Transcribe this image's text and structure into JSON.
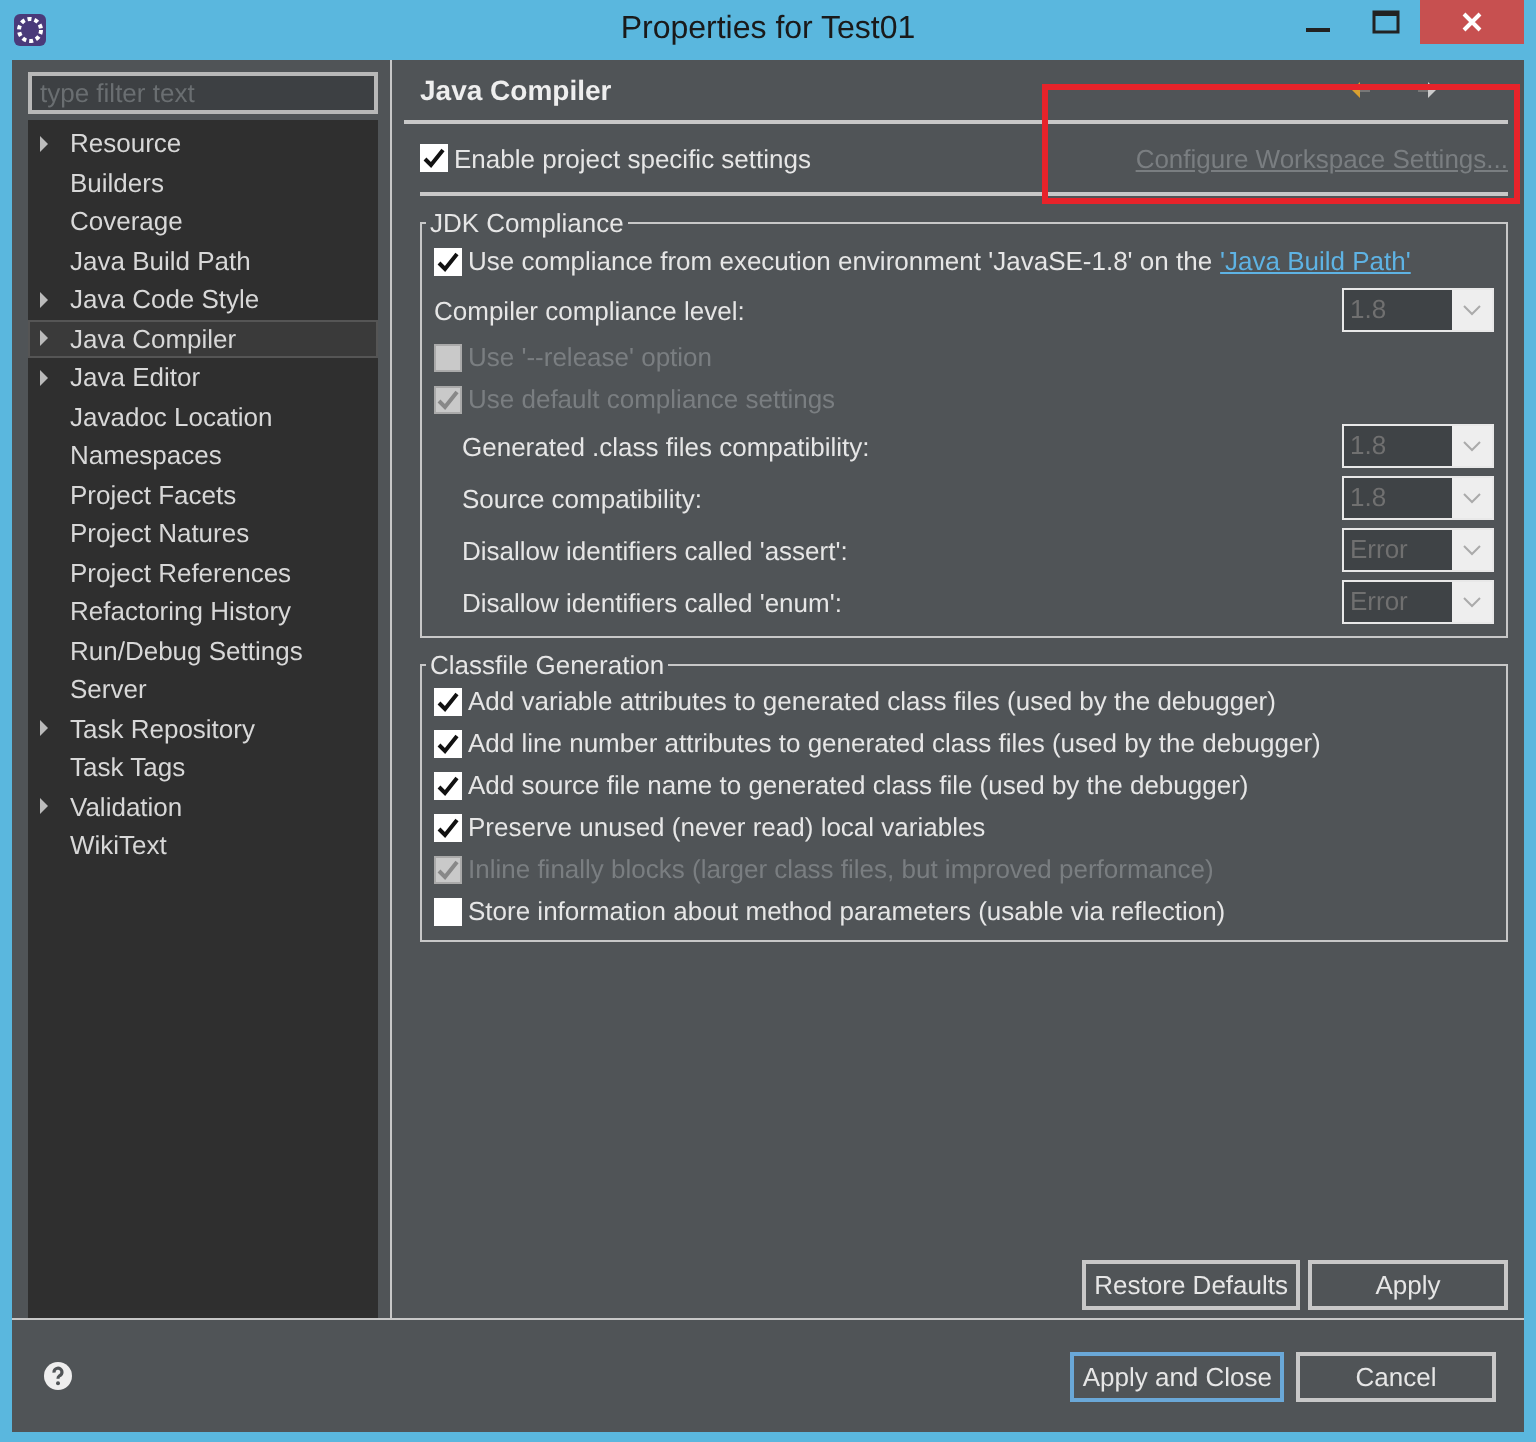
{
  "window": {
    "title": "Properties for Test01"
  },
  "filter": {
    "placeholder": "type filter text"
  },
  "sidebar": {
    "items": [
      {
        "label": "Resource",
        "expandable": true,
        "selected": false
      },
      {
        "label": "Builders",
        "expandable": false,
        "selected": false
      },
      {
        "label": "Coverage",
        "expandable": false,
        "selected": false
      },
      {
        "label": "Java Build Path",
        "expandable": false,
        "selected": false
      },
      {
        "label": "Java Code Style",
        "expandable": true,
        "selected": false
      },
      {
        "label": "Java Compiler",
        "expandable": true,
        "selected": true
      },
      {
        "label": "Java Editor",
        "expandable": true,
        "selected": false
      },
      {
        "label": "Javadoc Location",
        "expandable": false,
        "selected": false
      },
      {
        "label": "Namespaces",
        "expandable": false,
        "selected": false
      },
      {
        "label": "Project Facets",
        "expandable": false,
        "selected": false
      },
      {
        "label": "Project Natures",
        "expandable": false,
        "selected": false
      },
      {
        "label": "Project References",
        "expandable": false,
        "selected": false
      },
      {
        "label": "Refactoring History",
        "expandable": false,
        "selected": false
      },
      {
        "label": "Run/Debug Settings",
        "expandable": false,
        "selected": false
      },
      {
        "label": "Server",
        "expandable": false,
        "selected": false
      },
      {
        "label": "Task Repository",
        "expandable": true,
        "selected": false
      },
      {
        "label": "Task Tags",
        "expandable": false,
        "selected": false
      },
      {
        "label": "Validation",
        "expandable": true,
        "selected": false
      },
      {
        "label": "WikiText",
        "expandable": false,
        "selected": false
      }
    ]
  },
  "page": {
    "title": "Java Compiler"
  },
  "enable_project_settings": {
    "label": "Enable project specific settings",
    "checked": true
  },
  "configure_link": {
    "label": "Configure Workspace Settings...",
    "disabled": true,
    "highlighted": true
  },
  "jdk_compliance": {
    "title": "JDK Compliance",
    "rows": [
      {
        "kind": "check_link",
        "label": "Use compliance from execution environment 'JavaSE-1.8' on the",
        "link": "'Java Build Path'",
        "checked": true,
        "disabled": false
      },
      {
        "kind": "select",
        "label": "Compiler compliance level:",
        "value": "1.8",
        "indented": false,
        "disabled": true
      },
      {
        "kind": "check",
        "label": "Use '--release' option",
        "checked": false,
        "disabled": true
      },
      {
        "kind": "check",
        "label": "Use default compliance settings",
        "checked": true,
        "disabled": true
      },
      {
        "kind": "select",
        "label": "Generated .class files compatibility:",
        "value": "1.8",
        "indented": true,
        "disabled": true
      },
      {
        "kind": "select",
        "label": "Source compatibility:",
        "value": "1.8",
        "indented": true,
        "disabled": true
      },
      {
        "kind": "select",
        "label": "Disallow identifiers called 'assert':",
        "value": "Error",
        "indented": true,
        "disabled": true
      },
      {
        "kind": "select",
        "label": "Disallow identifiers called 'enum':",
        "value": "Error",
        "indented": true,
        "disabled": true
      }
    ]
  },
  "classfile_generation": {
    "title": "Classfile Generation",
    "options": [
      {
        "label": "Add variable attributes to generated class files (used by the debugger)",
        "checked": true,
        "disabled": false
      },
      {
        "label": "Add line number attributes to generated class files (used by the debugger)",
        "checked": true,
        "disabled": false
      },
      {
        "label": "Add source file name to generated class file (used by the debugger)",
        "checked": true,
        "disabled": false
      },
      {
        "label": "Preserve unused (never read) local variables",
        "checked": true,
        "disabled": false
      },
      {
        "label": "Inline finally blocks (larger class files, but improved performance)",
        "checked": true,
        "disabled": true
      },
      {
        "label": "Store information about method parameters (usable via reflection)",
        "checked": false,
        "disabled": false
      }
    ]
  },
  "page_buttons": [
    {
      "label": "Restore Defaults",
      "focused": false
    },
    {
      "label": "Apply",
      "focused": false
    }
  ],
  "dialog_buttons": [
    {
      "label": "Apply and Close",
      "focused": true
    },
    {
      "label": "Cancel",
      "focused": false
    }
  ]
}
